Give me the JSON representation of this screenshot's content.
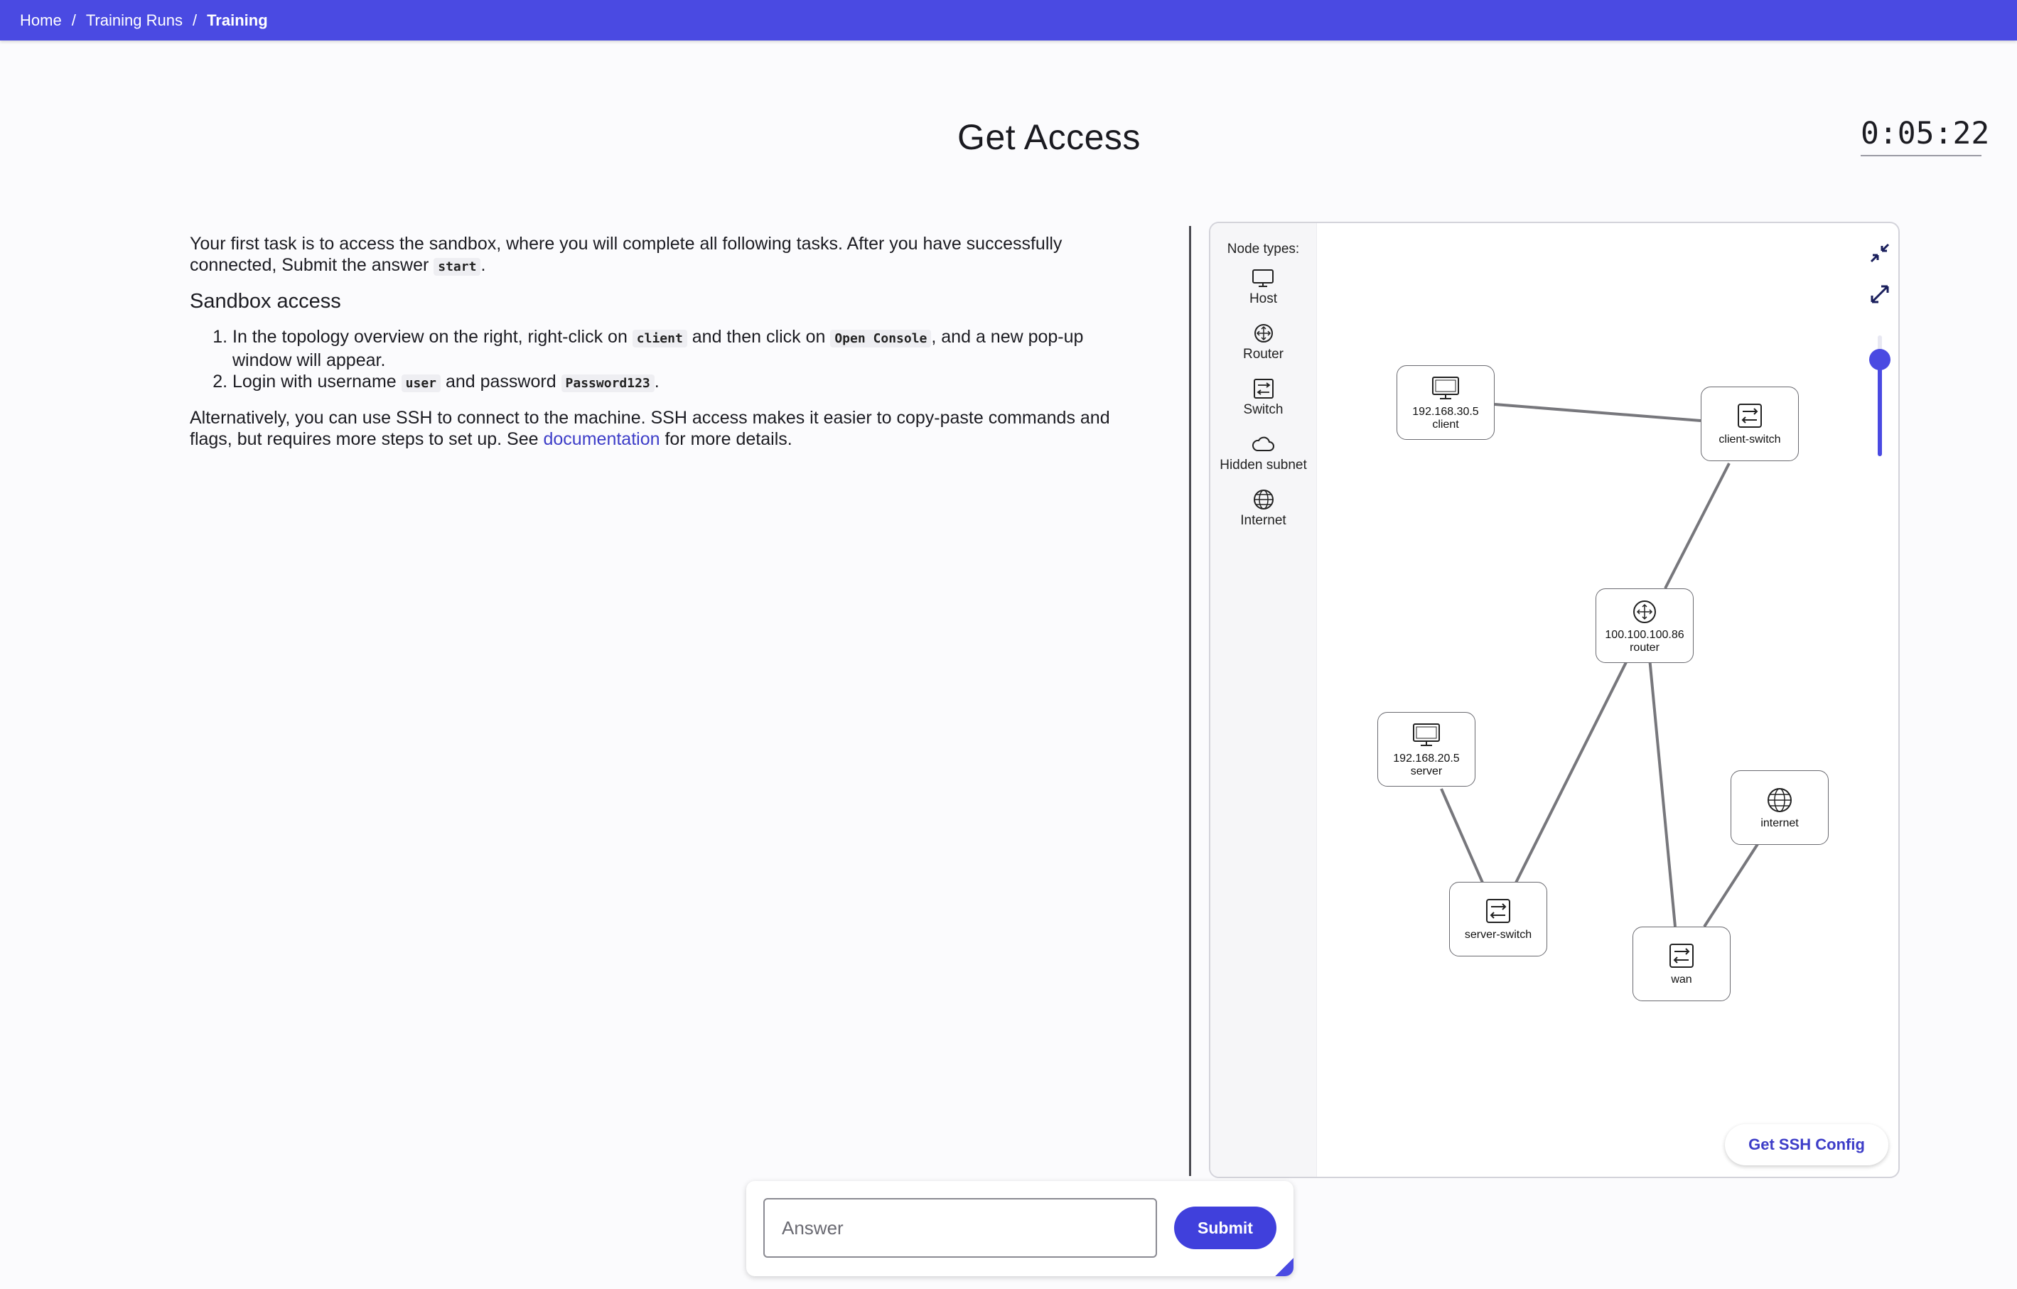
{
  "breadcrumb": {
    "items": [
      "Home",
      "Training Runs",
      "Training"
    ],
    "separator": "/"
  },
  "page": {
    "title": "Get Access",
    "timer": "0:05:22"
  },
  "content": {
    "intro_before": "Your first task is to access the sandbox, where you will complete all following tasks. After you have successfully connected, Submit the answer ",
    "intro_code": "start",
    "intro_after": ".",
    "heading": "Sandbox access",
    "step1": {
      "t1": "In the topology overview on the right, right-click on ",
      "c1": "client",
      "t2": " and then click on ",
      "c2": "Open Console",
      "t3": ", and a new pop-up window will appear."
    },
    "step2": {
      "t1": "Login with username ",
      "c1": "user",
      "t2": " and password ",
      "c2": "Password123",
      "t3": "."
    },
    "alt_before": "Alternatively, you can use SSH to connect to the machine. SSH access makes it easier to copy-paste commands and flags, but requires more steps to set up. See ",
    "alt_link": "documentation",
    "alt_after": " for more details."
  },
  "topology": {
    "legend_title": "Node types:",
    "legend": [
      {
        "label": "Host",
        "icon": "monitor-icon"
      },
      {
        "label": "Router",
        "icon": "router-icon"
      },
      {
        "label": "Switch",
        "icon": "switch-icon"
      },
      {
        "label": "Hidden subnet",
        "icon": "cloud-icon"
      },
      {
        "label": "Internet",
        "icon": "globe-icon"
      }
    ],
    "nodes": {
      "client": {
        "ip": "192.168.30.5",
        "name": "client",
        "type": "host"
      },
      "client_switch": {
        "name": "client-switch",
        "type": "switch"
      },
      "router": {
        "ip": "100.100.100.86",
        "name": "router",
        "type": "router"
      },
      "server": {
        "ip": "192.168.20.5",
        "name": "server",
        "type": "host"
      },
      "server_switch": {
        "name": "server-switch",
        "type": "switch"
      },
      "internet": {
        "name": "internet",
        "type": "internet"
      },
      "wan": {
        "name": "wan",
        "type": "switch"
      }
    },
    "links": [
      [
        "client",
        "client_switch"
      ],
      [
        "client_switch",
        "router"
      ],
      [
        "router",
        "server_switch"
      ],
      [
        "router",
        "wan"
      ],
      [
        "server",
        "server_switch"
      ],
      [
        "internet",
        "wan"
      ]
    ],
    "zoom_level": 0.8,
    "ssh_button": "Get SSH Config"
  },
  "answer": {
    "placeholder": "Answer",
    "submit": "Submit"
  },
  "colors": {
    "accent": "#4a4ae2",
    "link": "#3d3dc8",
    "edge": "#77777c"
  }
}
